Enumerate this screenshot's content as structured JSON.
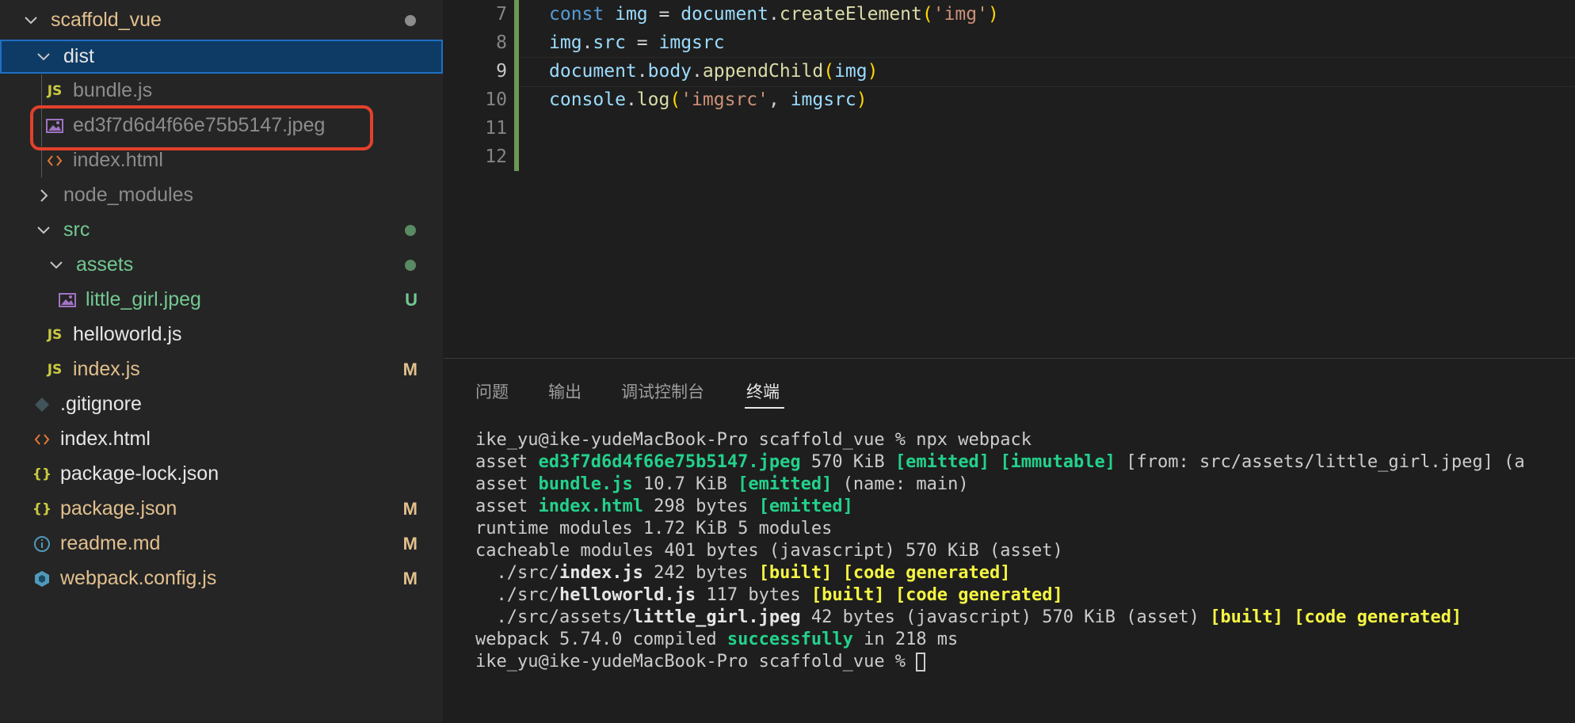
{
  "explorer": {
    "items": [
      {
        "label": "scaffold_vue",
        "badge": "",
        "type": "folder-open"
      },
      {
        "label": "dist",
        "badge": "",
        "type": "folder-open"
      },
      {
        "label": "bundle.js",
        "badge": "",
        "type": "js"
      },
      {
        "label": "ed3f7d6d4f66e75b5147.jpeg",
        "badge": "",
        "type": "image"
      },
      {
        "label": "index.html",
        "badge": "",
        "type": "html"
      },
      {
        "label": "node_modules",
        "badge": "",
        "type": "folder-closed"
      },
      {
        "label": "src",
        "badge": "",
        "type": "folder-open"
      },
      {
        "label": "assets",
        "badge": "",
        "type": "folder-open"
      },
      {
        "label": "little_girl.jpeg",
        "badge": "U",
        "type": "image"
      },
      {
        "label": "helloworld.js",
        "badge": "",
        "type": "js"
      },
      {
        "label": "index.js",
        "badge": "M",
        "type": "js"
      },
      {
        "label": ".gitignore",
        "badge": "",
        "type": "git"
      },
      {
        "label": "index.html",
        "badge": "",
        "type": "html"
      },
      {
        "label": "package-lock.json",
        "badge": "",
        "type": "json"
      },
      {
        "label": "package.json",
        "badge": "M",
        "type": "json"
      },
      {
        "label": "readme.md",
        "badge": "M",
        "type": "info"
      },
      {
        "label": "webpack.config.js",
        "badge": "M",
        "type": "webpack"
      }
    ],
    "js_icon_text": "JS",
    "json_icon_text": "{}"
  },
  "editor": {
    "line_numbers": [
      "7",
      "8",
      "9",
      "10",
      "11",
      "12"
    ],
    "lines": [
      {
        "t1": "const",
        "t2": "img",
        "t3": " = ",
        "t4": "document",
        "t5": ".",
        "t6": "createElement",
        "t7": "(",
        "t8": "'img'",
        "t9": ")"
      },
      {
        "t1": "img",
        "t2": ".",
        "t3": "src",
        "t4": " = ",
        "t5": "imgsrc"
      },
      {
        "t1": "document",
        "t2": ".",
        "t3": "body",
        "t4": ".",
        "t5": "appendChild",
        "t6": "(",
        "t7": "img",
        "t8": ")"
      },
      {
        "t1": "console",
        "t2": ".",
        "t3": "log",
        "t4": "(",
        "t5": "'imgsrc'",
        "t6": ", ",
        "t7": "imgsrc",
        "t8": ")"
      }
    ]
  },
  "panel": {
    "tabs": [
      "问题",
      "输出",
      "调试控制台",
      "终端"
    ],
    "terminal": {
      "l1": "ike_yu@ike-yudeMacBook-Pro scaffold_vue % npx webpack",
      "l2": {
        "a": "asset ",
        "b": "ed3f7d6d4f66e75b5147.jpeg",
        "c": " 570 KiB ",
        "d": "[emitted]",
        "e": " ",
        "f": "[immutable]",
        "g": " [from: src/assets/little_girl.jpeg] (a"
      },
      "l3": {
        "a": "asset ",
        "b": "bundle.js",
        "c": " 10.7 KiB ",
        "d": "[emitted]",
        "e": " (name: main)"
      },
      "l4": {
        "a": "asset ",
        "b": "index.html",
        "c": " 298 bytes ",
        "d": "[emitted]"
      },
      "l5": "runtime modules 1.72 KiB 5 modules",
      "l6": "cacheable modules 401 bytes (javascript) 570 KiB (asset)",
      "l7": {
        "a": "  ./src/",
        "b": "index.js",
        "c": " 242 bytes ",
        "d": "[built]",
        "e": " ",
        "f": "[code generated]"
      },
      "l8": {
        "a": "  ./src/",
        "b": "helloworld.js",
        "c": " 117 bytes ",
        "d": "[built]",
        "e": " ",
        "f": "[code generated]"
      },
      "l9": {
        "a": "  ./src/assets/",
        "b": "little_girl.jpeg",
        "c": " 42 bytes (javascript) 570 KiB (asset) ",
        "d": "[built]",
        "e": " ",
        "f": "[code generated]"
      },
      "l10": {
        "a": "webpack 5.74.0 compiled ",
        "b": "successfully",
        "c": " in 218 ms"
      },
      "l11": "ike_yu@ike-yudeMacBook-Pro scaffold_vue % "
    }
  },
  "colors": {
    "sidebar_bg": "#252526",
    "selection": "#0e3b66",
    "highlight_box": "#e2412b",
    "git_untracked": "#73c991",
    "git_modified": "#e2c08d",
    "terminal_green": "#23d18b",
    "terminal_yellow": "#f5f543"
  }
}
